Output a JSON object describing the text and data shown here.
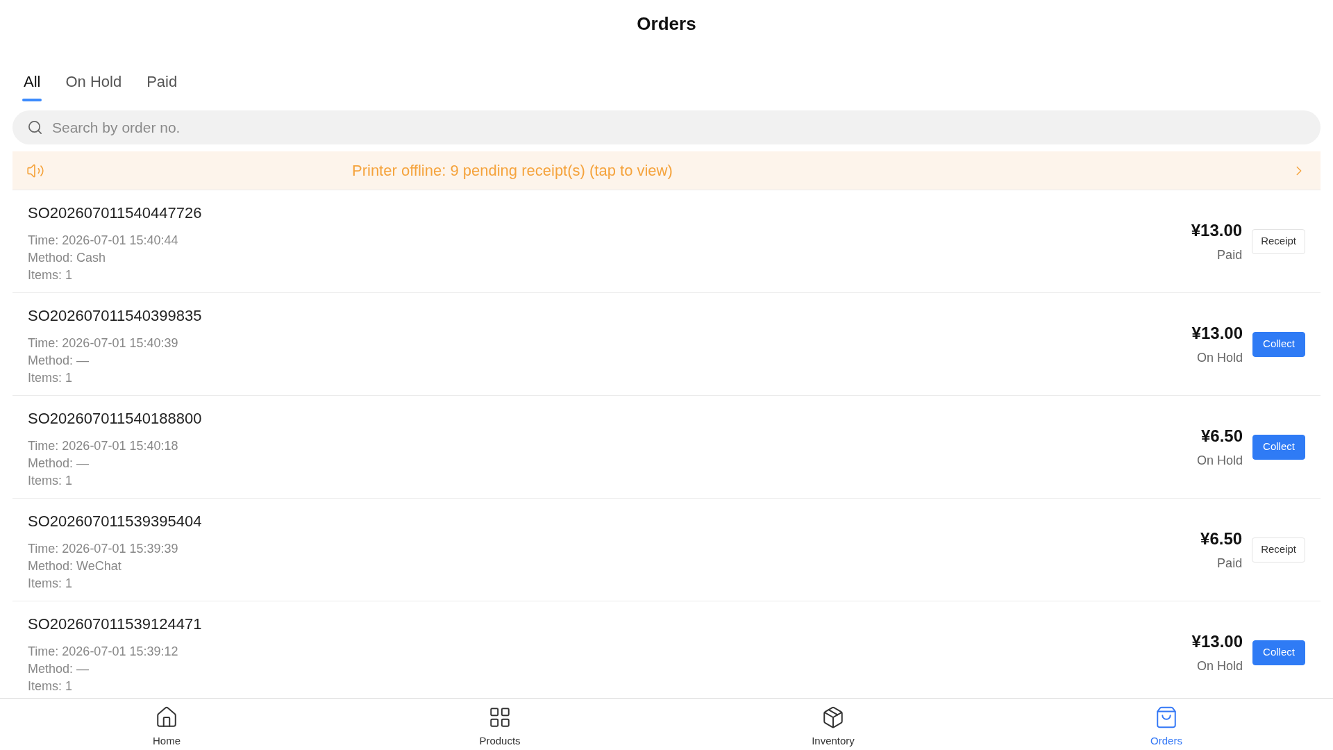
{
  "header": {
    "title": "Orders"
  },
  "tabs": [
    {
      "label": "All",
      "selected": true
    },
    {
      "label": "On Hold",
      "selected": false
    },
    {
      "label": "Paid",
      "selected": false
    }
  ],
  "search": {
    "placeholder": "Search by order no."
  },
  "notice": {
    "text": "Printer offline: 9 pending receipt(s) (tap to view)"
  },
  "orders": [
    {
      "order_no": "SO202607011540447726",
      "time": "Time: 2026-07-01 15:40:44",
      "method": "Method: Cash",
      "items": "Items: 1",
      "amount": "¥13.00",
      "status": "Paid",
      "action": {
        "kind": "receipt",
        "label": "Receipt"
      }
    },
    {
      "order_no": "SO202607011540399835",
      "time": "Time: 2026-07-01 15:40:39",
      "method": "Method: —",
      "items": "Items: 1",
      "amount": "¥13.00",
      "status": "On Hold",
      "action": {
        "kind": "collect",
        "label": "Collect"
      }
    },
    {
      "order_no": "SO202607011540188800",
      "time": "Time: 2026-07-01 15:40:18",
      "method": "Method: —",
      "items": "Items: 1",
      "amount": "¥6.50",
      "status": "On Hold",
      "action": {
        "kind": "collect",
        "label": "Collect"
      }
    },
    {
      "order_no": "SO202607011539395404",
      "time": "Time: 2026-07-01 15:39:39",
      "method": "Method: WeChat",
      "items": "Items: 1",
      "amount": "¥6.50",
      "status": "Paid",
      "action": {
        "kind": "receipt",
        "label": "Receipt"
      }
    },
    {
      "order_no": "SO202607011539124471",
      "time": "Time: 2026-07-01 15:39:12",
      "method": "Method: —",
      "items": "Items: 1",
      "amount": "¥13.00",
      "status": "On Hold",
      "action": {
        "kind": "collect",
        "label": "Collect"
      }
    }
  ],
  "bottom_nav": [
    {
      "label": "Home",
      "selected": false
    },
    {
      "label": "Products",
      "selected": false
    },
    {
      "label": "Inventory",
      "selected": false
    },
    {
      "label": "Orders",
      "selected": true
    }
  ]
}
